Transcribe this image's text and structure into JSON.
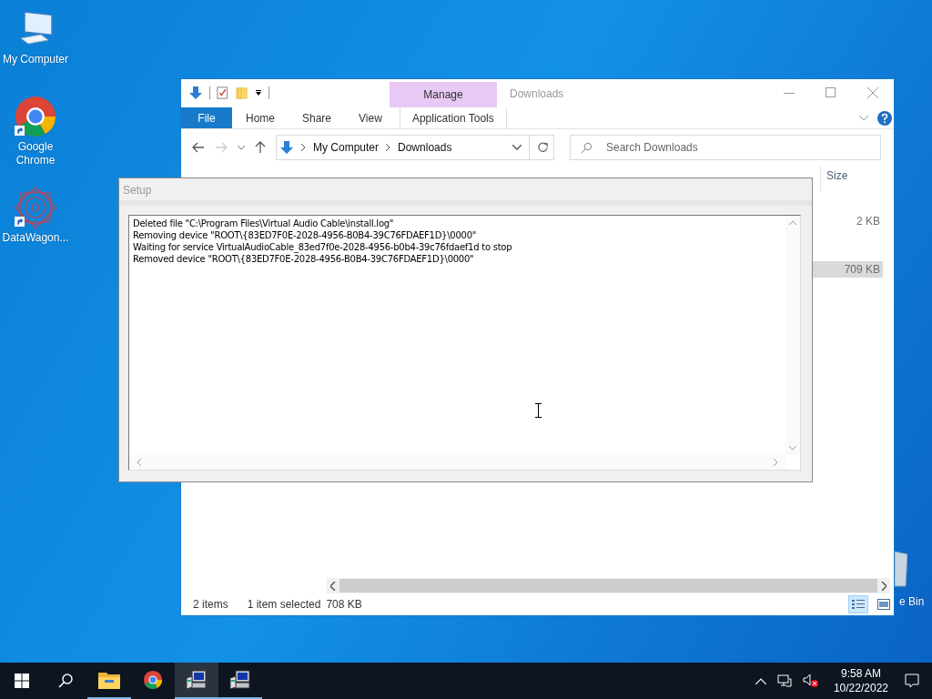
{
  "desktop": {
    "icons": [
      {
        "label": "My Computer",
        "kind": "computer",
        "shortcut": false
      },
      {
        "label": "Google Chrome",
        "kind": "chrome",
        "shortcut": true
      },
      {
        "label": "DataWagon...",
        "kind": "web",
        "shortcut": true
      },
      {
        "label": "e Bin",
        "kind": "bin",
        "shortcut": false
      }
    ]
  },
  "explorer": {
    "title": "Downloads",
    "context_tab": "Manage",
    "ribbon_tabs": [
      {
        "label": "File",
        "kind": "file"
      },
      {
        "label": "Home",
        "kind": "plain"
      },
      {
        "label": "Share",
        "kind": "plain"
      },
      {
        "label": "View",
        "kind": "plain"
      },
      {
        "label": "Application Tools",
        "kind": "context"
      }
    ],
    "breadcrumb": [
      "My Computer",
      "Downloads"
    ],
    "search": {
      "placeholder": "Search Downloads"
    },
    "columns": [
      "Size"
    ],
    "rows": [
      {
        "size": "2 KB",
        "selected": false
      },
      {
        "size": "709 KB",
        "selected": true
      }
    ],
    "status_bar": {
      "count": "2 items",
      "selection": "1 item selected",
      "size": "708 KB"
    },
    "views": [
      {
        "kind": "details",
        "selected": true
      },
      {
        "kind": "preview",
        "selected": false
      }
    ]
  },
  "setup": {
    "title": "Setup",
    "log": [
      "Deleted file \"C:\\Program Files\\Virtual Audio Cable\\install.log\"",
      "Removing device \"ROOT\\{83ED7F0E-2028-4956-B0B4-39C76FDAEF1D}\\0000\"",
      "Waiting for service VirtualAudioCable_83ed7f0e-2028-4956-b0b4-39c76fdaef1d to stop",
      "Removed device \"ROOT\\{83ED7F0E-2028-4956-B0B4-39C76FDAEF1D}\\0000\""
    ]
  },
  "taskbar": {
    "apps": [
      {
        "kind": "explorer",
        "running": true,
        "selected": false
      },
      {
        "kind": "chrome",
        "running": false,
        "selected": false
      },
      {
        "kind": "setup",
        "running": true,
        "selected": true
      },
      {
        "kind": "setup",
        "running": true,
        "selected": false
      }
    ],
    "time": "9:58 AM",
    "date": "10/22/2022"
  }
}
